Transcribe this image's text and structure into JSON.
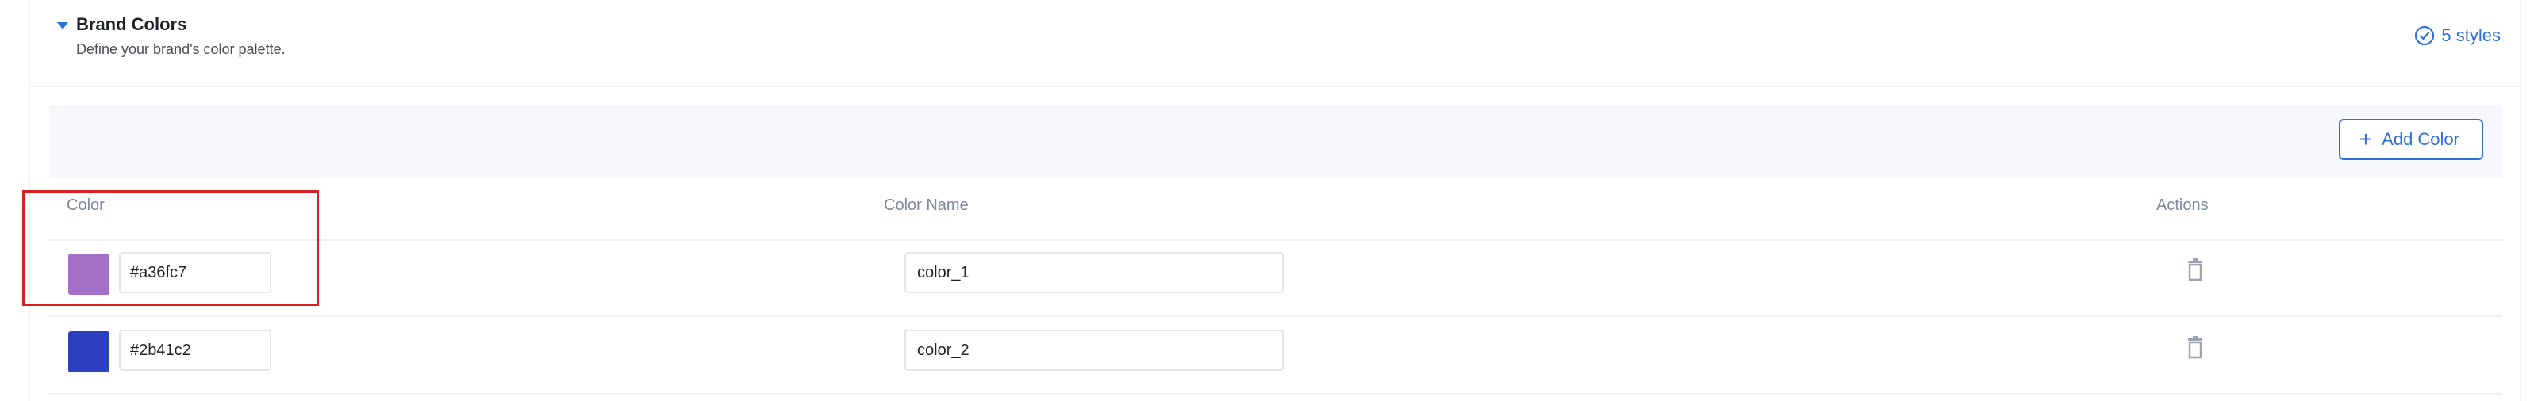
{
  "section": {
    "title": "Brand Colors",
    "description": "Define your brand's color palette.",
    "styles_count": "5 styles",
    "accent_color": "#2f6fdc"
  },
  "toolbar": {
    "add_label": "Add Color"
  },
  "table": {
    "columns": [
      "Color",
      "Color Name",
      "Actions"
    ],
    "rows": [
      {
        "hex": "#a36fc7",
        "name": "color_1"
      },
      {
        "hex": "#2b41c2",
        "name": "color_2"
      }
    ]
  },
  "icons": {
    "collapse": "caret-down-icon",
    "styles": "check-circle-icon",
    "add": "plus-icon",
    "delete": "trash-icon"
  },
  "highlight_color": "#d92020"
}
